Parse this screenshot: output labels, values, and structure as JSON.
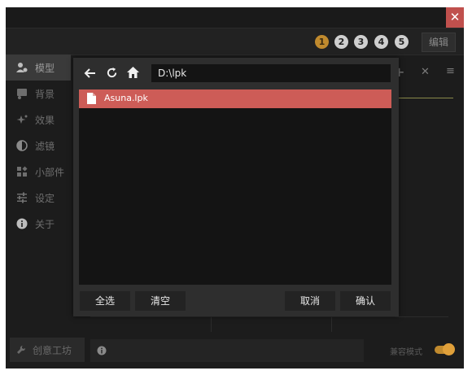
{
  "titlebar": {
    "close_label": "✕"
  },
  "toolbar": {
    "tabs": [
      {
        "label": "1",
        "active": true
      },
      {
        "label": "2",
        "active": false
      },
      {
        "label": "3",
        "active": false
      },
      {
        "label": "4",
        "active": false
      },
      {
        "label": "5",
        "active": false
      }
    ],
    "edit_label": "编辑"
  },
  "sidebar": {
    "items": [
      {
        "label": "模型",
        "icon": "model-icon",
        "active": true
      },
      {
        "label": "背景",
        "icon": "background-icon"
      },
      {
        "label": "效果",
        "icon": "effect-icon"
      },
      {
        "label": "滤镜",
        "icon": "filter-icon"
      },
      {
        "label": "小部件",
        "icon": "widget-icon"
      },
      {
        "label": "设定",
        "icon": "settings-icon"
      },
      {
        "label": "关于",
        "icon": "info-icon"
      }
    ]
  },
  "content_toolbar": {
    "add_label": "+",
    "remove_label": "✕",
    "menu_label": "≡"
  },
  "bottom": {
    "workshop_label": "创意工坊",
    "compat_label": "兼容模式",
    "compat_enabled": true
  },
  "dialog": {
    "path_value": "D:\\lpk",
    "files": [
      {
        "name": "Asuna.lpk",
        "selected": true
      }
    ],
    "select_all_label": "全选",
    "clear_label": "清空",
    "cancel_label": "取消",
    "confirm_label": "确认"
  },
  "colors": {
    "accent": "#c08a2e",
    "selection": "#cd5c57",
    "close": "#c0504d"
  }
}
